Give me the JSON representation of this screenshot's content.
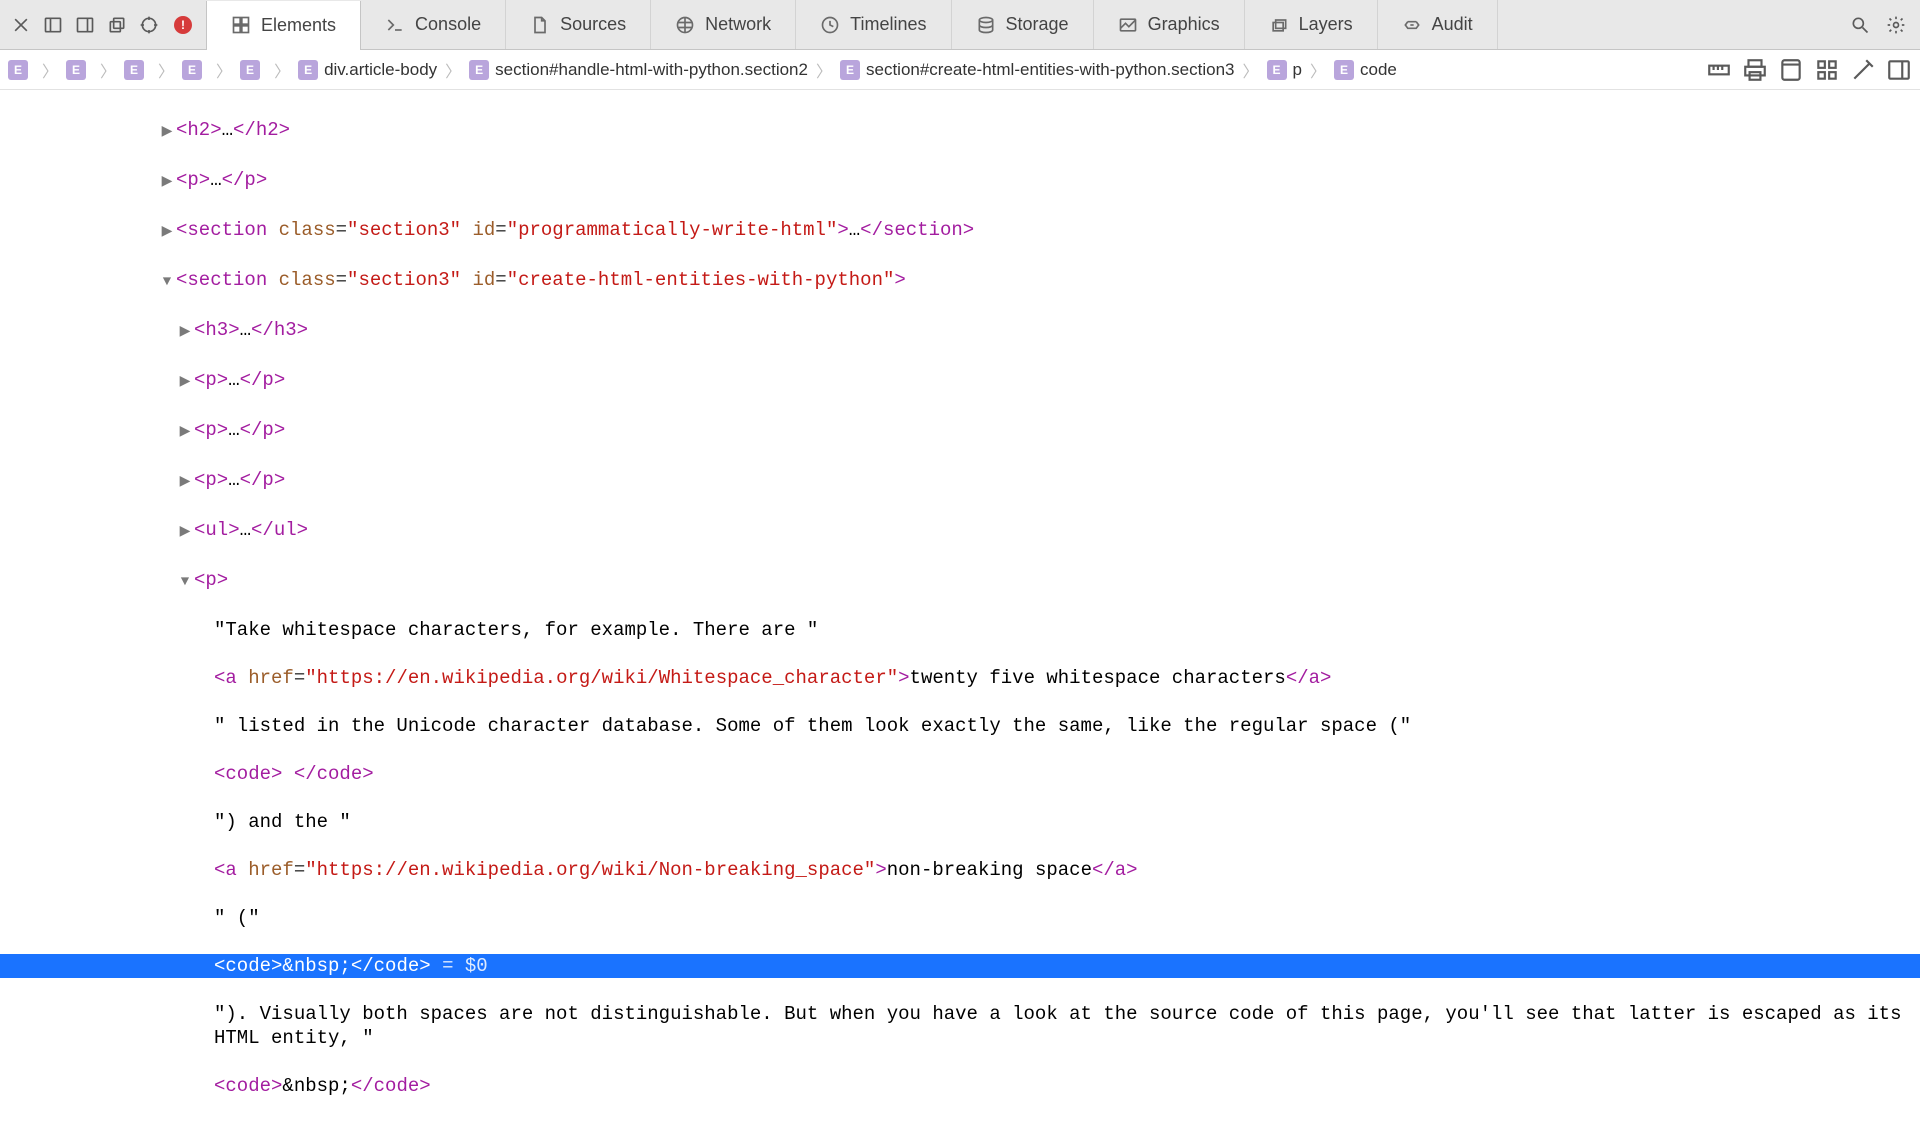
{
  "tabs": {
    "elements": "Elements",
    "console": "Console",
    "sources": "Sources",
    "network": "Network",
    "timelines": "Timelines",
    "storage": "Storage",
    "graphics": "Graphics",
    "layers": "Layers",
    "audit": "Audit"
  },
  "error_badge": "!",
  "breadcrumb": {
    "items": [
      {
        "label": ""
      },
      {
        "label": ""
      },
      {
        "label": ""
      },
      {
        "label": ""
      },
      {
        "label": ""
      },
      {
        "label": "div.article-body"
      },
      {
        "label": "section#handle-html-with-python.section2"
      },
      {
        "label": "section#create-html-entities-with-python.section3"
      },
      {
        "label": "p"
      },
      {
        "label": "code"
      }
    ]
  },
  "dom": {
    "l0_indent": 160,
    "l1_indent": 178,
    "l2_indent": 196,
    "l3_indent": 214,
    "h2": {
      "o": "<h2>",
      "mid": "…",
      "c": "</h2>"
    },
    "p0": {
      "o": "<p>",
      "mid": "…",
      "c": "</p>"
    },
    "sec1": {
      "o": "<section",
      "cls_n": "class",
      "cls_v": "\"section3\"",
      "id_n": "id",
      "id_v": "\"programmatically-write-html\"",
      "close": ">",
      "mid": "…",
      "c": "</section>"
    },
    "sec2": {
      "o": "<section",
      "cls_n": "class",
      "cls_v": "\"section3\"",
      "id_n": "id",
      "id_v": "\"create-html-entities-with-python\"",
      "close": ">"
    },
    "h3": {
      "o": "<h3>",
      "mid": "…",
      "c": "</h3>"
    },
    "p1": {
      "o": "<p>",
      "mid": "…",
      "c": "</p>"
    },
    "p2": {
      "o": "<p>",
      "mid": "…",
      "c": "</p>"
    },
    "p3": {
      "o": "<p>",
      "mid": "…",
      "c": "</p>"
    },
    "ul": {
      "o": "<ul>",
      "mid": "…",
      "c": "</ul>"
    },
    "p4": {
      "o": "<p>"
    },
    "t1": "\"Take whitespace characters, for example. There are \"",
    "a1": {
      "o": "<a",
      "hn": "href",
      "hv": "\"https://en.wikipedia.org/wiki/Whitespace_character\"",
      "close": ">",
      "txt": "twenty five whitespace characters",
      "c": "</a>"
    },
    "t2": "\" listed in the Unicode character database. Some of them look exactly the same, like the regular space (\"",
    "code1": {
      "o": "<code>",
      "txt": " ",
      "c": "</code>"
    },
    "t3": "\") and the \"",
    "a2": {
      "o": "<a",
      "hn": "href",
      "hv": "\"https://en.wikipedia.org/wiki/Non-breaking_space\"",
      "close": ">",
      "txt": "non-breaking space",
      "c": "</a>"
    },
    "t4": "\" (\"",
    "code2": {
      "o": "<code>",
      "txt": "&nbsp;",
      "c": "</code>"
    },
    "sel_suffix": " = $0",
    "t5": "\"). Visually both spaces are not distinguishable. But when you have a look at the source code of this page, you'll see that latter is escaped as its HTML entity, \"",
    "code3": {
      "o": "<code>",
      "txt": "&nbsp;",
      "c": "</code>"
    }
  }
}
